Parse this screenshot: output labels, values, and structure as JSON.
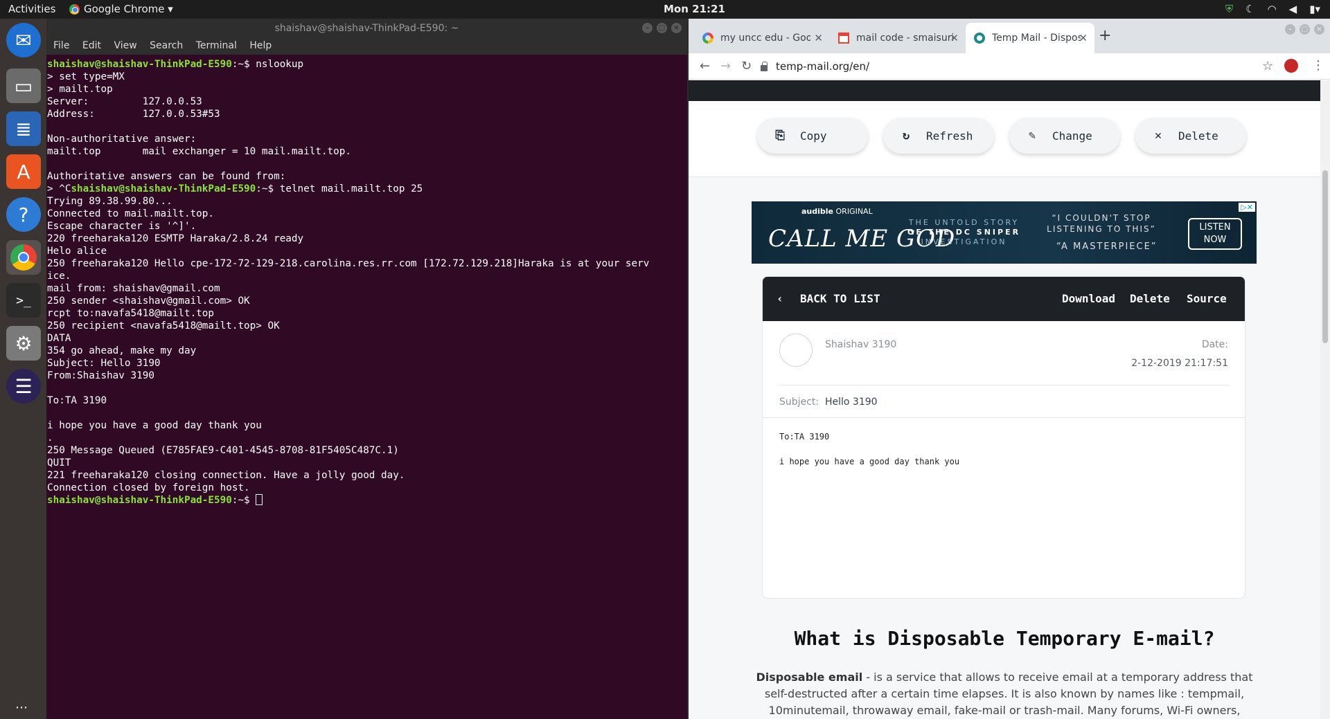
{
  "topbar": {
    "activities": "Activities",
    "app_name": "Google Chrome ▾",
    "clock": "Mon 21:21"
  },
  "terminal": {
    "title": "shaishav@shaishav-ThinkPad-E590: ~",
    "menu": [
      "File",
      "Edit",
      "View",
      "Search",
      "Terminal",
      "Help"
    ],
    "prompt_user": "shaishav@shaishav-ThinkPad-E590",
    "prompt_tail": ":~$",
    "lines": [
      {
        "p": "shaishav@shaishav-ThinkPad-E590",
        "t": ":~$ nslookup"
      },
      {
        "p": "",
        "t": "> set type=MX"
      },
      {
        "p": "",
        "t": "> mailt.top"
      },
      {
        "p": "",
        "t": "Server:         127.0.0.53"
      },
      {
        "p": "",
        "t": "Address:        127.0.0.53#53"
      },
      {
        "p": "",
        "t": ""
      },
      {
        "p": "",
        "t": "Non-authoritative answer:"
      },
      {
        "p": "",
        "t": "mailt.top       mail exchanger = 10 mail.mailt.top."
      },
      {
        "p": "",
        "t": ""
      },
      {
        "p": "",
        "t": "Authoritative answers can be found from:"
      },
      {
        "p": "",
        "t": "> ^C",
        "p2": "shaishav@shaishav-ThinkPad-E590",
        "t2": ":~$ telnet mail.mailt.top 25"
      },
      {
        "p": "",
        "t": "Trying 89.38.99.80..."
      },
      {
        "p": "",
        "t": "Connected to mail.mailt.top."
      },
      {
        "p": "",
        "t": "Escape character is '^]'."
      },
      {
        "p": "",
        "t": "220 freeharaka120 ESMTP Haraka/2.8.24 ready"
      },
      {
        "p": "",
        "t": "Helo alice"
      },
      {
        "p": "",
        "t": "250 freeharaka120 Hello cpe-172-72-129-218.carolina.res.rr.com [172.72.129.218]Haraka is at your serv"
      },
      {
        "p": "",
        "t": "ice."
      },
      {
        "p": "",
        "t": "mail from: shaishav@gmail.com"
      },
      {
        "p": "",
        "t": "250 sender <shaishav@gmail.com> OK"
      },
      {
        "p": "",
        "t": "rcpt to:navafa5418@mailt.top"
      },
      {
        "p": "",
        "t": "250 recipient <navafa5418@mailt.top> OK"
      },
      {
        "p": "",
        "t": "DATA"
      },
      {
        "p": "",
        "t": "354 go ahead, make my day"
      },
      {
        "p": "",
        "t": "Subject: Hello 3190"
      },
      {
        "p": "",
        "t": "From:Shaishav 3190"
      },
      {
        "p": "",
        "t": ""
      },
      {
        "p": "",
        "t": "To:TA 3190"
      },
      {
        "p": "",
        "t": ""
      },
      {
        "p": "",
        "t": "i hope you have a good day thank you"
      },
      {
        "p": "",
        "t": "."
      },
      {
        "p": "",
        "t": "250 Message Queued (E785FAE9-C401-4545-8708-81F5405C487C.1)"
      },
      {
        "p": "",
        "t": "QUIT"
      },
      {
        "p": "",
        "t": "221 freeharaka120 closing connection. Have a jolly good day."
      },
      {
        "p": "",
        "t": "Connection closed by foreign host."
      },
      {
        "p": "shaishav@shaishav-ThinkPad-E590",
        "t": ":~$ ",
        "cursor": true
      }
    ]
  },
  "browser": {
    "tabs": [
      {
        "label": "my uncc edu - Google Search",
        "icon": "google-icon"
      },
      {
        "label": "mail code - smaisuri@uncc.edu",
        "icon": "gmail-icon"
      },
      {
        "label": "Temp Mail - Disposable Temporary Email",
        "icon": "tempmail-icon"
      }
    ],
    "url": "temp-mail.org/en/"
  },
  "page": {
    "actions": [
      {
        "label": "Copy",
        "icon": "copy-icon",
        "glyph": "⎘"
      },
      {
        "label": "Refresh",
        "icon": "refresh-icon",
        "glyph": "↻"
      },
      {
        "label": "Change",
        "icon": "edit-icon",
        "glyph": "✎"
      },
      {
        "label": "Delete",
        "icon": "close-icon",
        "glyph": "✕"
      }
    ],
    "ad": {
      "brand_bold": "audible",
      "brand_rest": " ORIGINAL",
      "title": "CALL ME GOD",
      "story_line1": "THE UNTOLD STORY",
      "story_line2": "OF THE DC SNIPER",
      "story_line3": "INVESTIGATION",
      "quote1": "“I COULDN'T STOP LISTENING TO THIS”",
      "quote2": "“A MASTERPIECE”",
      "cta_line1": "LISTEN",
      "cta_line2": "NOW"
    },
    "mail": {
      "back": "BACK TO LIST",
      "download": "Download",
      "delete": "Delete",
      "source": "Source",
      "sender": "Shaishav 3190",
      "date_label": "Date:",
      "date": "2-12-2019 21:17:51",
      "subject_label": "Subject:",
      "subject": "Hello 3190",
      "body_line1": "To:TA 3190",
      "body_line2": "i hope you have a good day thank you"
    },
    "heading": "What is Disposable Temporary E-mail?",
    "para_bold": "Disposable email",
    "para_rest": " - is a service that allows to receive email at a temporary address that self-destructed after a certain time elapses. It is also known by names like : tempmail, 10minutemail, throwaway email, fake-mail or trash-mail. Many forums, Wi-Fi owners, websites and blogs ask visitors"
  }
}
